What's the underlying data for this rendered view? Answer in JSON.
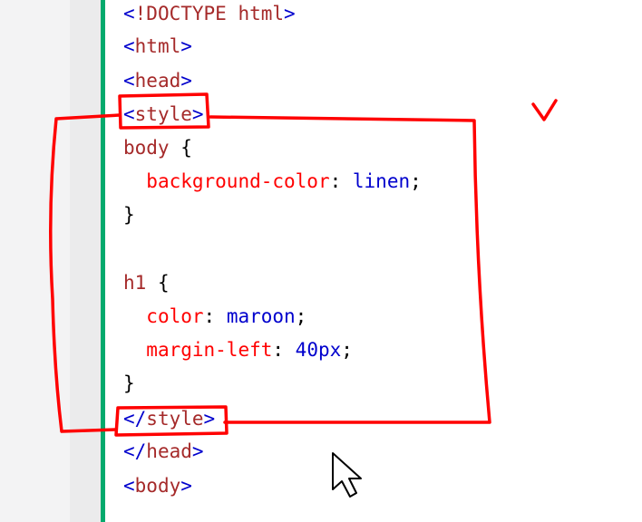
{
  "editor": {
    "accent_color": "#04aa6d",
    "lines": [
      {
        "open": "<",
        "tag": "!DOCTYPE html",
        "close": ">"
      },
      {
        "open": "<",
        "tag": "html",
        "close": ">"
      },
      {
        "open": "<",
        "tag": "head",
        "close": ">"
      },
      {
        "open": "<",
        "tag": "style",
        "close": ">"
      },
      {
        "selector": "body",
        "brace": " {"
      },
      {
        "indent": "  ",
        "property": "background-color",
        "colon": ": ",
        "value": "linen",
        "semi": ";"
      },
      {
        "brace": "}"
      },
      {
        "selector": "h1",
        "brace": " {"
      },
      {
        "indent": "  ",
        "property": "color",
        "colon": ": ",
        "value": "maroon",
        "semi": ";"
      },
      {
        "indent": "  ",
        "property": "margin-left",
        "colon": ": ",
        "value": "40px",
        "semi": ";"
      },
      {
        "brace": "}"
      },
      {
        "open": "</",
        "tag": "style",
        "close": ">"
      },
      {
        "open": "</",
        "tag": "head",
        "close": ">"
      },
      {
        "open": "<",
        "tag": "body",
        "close": ">"
      }
    ]
  },
  "annotations": {
    "ink_color": "#ff0000",
    "checkmark_icon": "check-mark-icon",
    "cursor_icon": "mouse-pointer-icon"
  }
}
